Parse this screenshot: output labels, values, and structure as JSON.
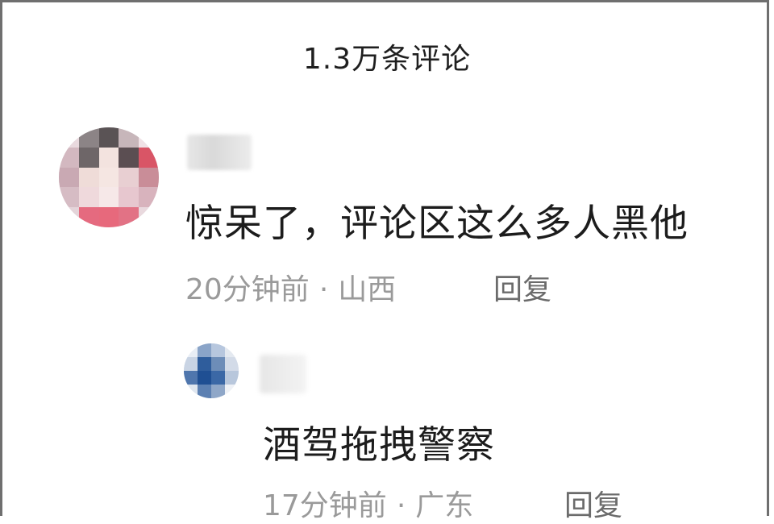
{
  "header": {
    "title": "1.3万条评论"
  },
  "comments": [
    {
      "text": "惊呆了，评论区这么多人黑他",
      "time": "20分钟前",
      "separator": "·",
      "location": "山西",
      "reply_label": "回复",
      "replies": [
        {
          "text": "酒驾拖拽警察",
          "time": "17分钟前",
          "separator": "·",
          "location": "广东",
          "reply_label": "回复"
        }
      ]
    }
  ]
}
